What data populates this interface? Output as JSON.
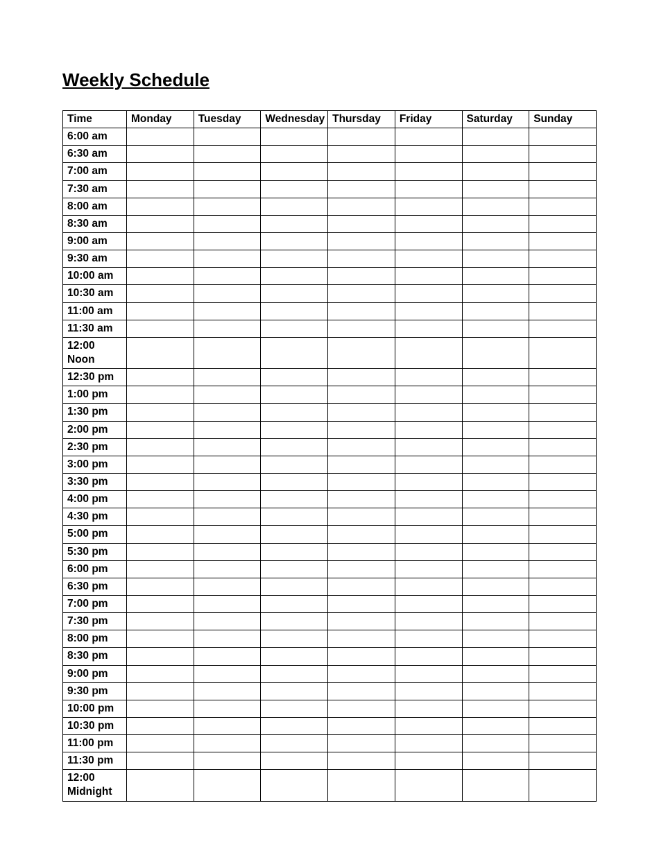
{
  "title": "Weekly Schedule",
  "headers": [
    "Time",
    "Monday",
    "Tuesday",
    "Wednesday",
    "Thursday",
    "Friday",
    "Saturday",
    "Sunday"
  ],
  "times": [
    "6:00 am",
    "6:30 am",
    "7:00 am",
    "7:30 am",
    "8:00 am",
    "8:30 am",
    "9:00 am",
    "9:30 am",
    "10:00 am",
    "10:30 am",
    "11:00 am",
    "11:30 am",
    "12:00 Noon",
    "12:30 pm",
    "1:00 pm",
    "1:30 pm",
    "2:00 pm",
    "2:30 pm",
    "3:00 pm",
    "3:30 pm",
    "4:00 pm",
    "4:30 pm",
    "5:00 pm",
    "5:30 pm",
    "6:00 pm",
    "6:30 pm",
    "7:00 pm",
    "7:30 pm",
    "8:00 pm",
    "8:30 pm",
    "9:00 pm",
    "9:30 pm",
    "10:00 pm",
    "10:30 pm",
    "11:00 pm",
    "11:30 pm",
    "12:00 Midnight"
  ]
}
